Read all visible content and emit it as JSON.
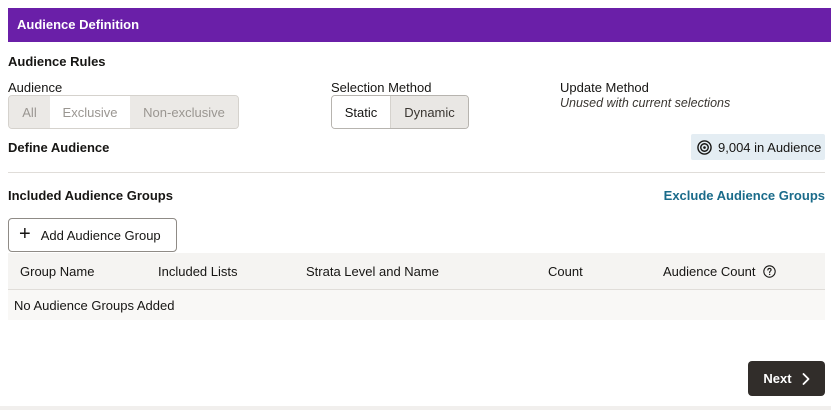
{
  "header": {
    "title": "Audience Definition"
  },
  "audience_rules": {
    "title": "Audience Rules",
    "audience": {
      "label": "Audience",
      "options": [
        "All",
        "Exclusive",
        "Non-exclusive"
      ]
    },
    "selection_method": {
      "label": "Selection Method",
      "options": [
        "Static",
        "Dynamic"
      ],
      "selected": "Static"
    },
    "update_method": {
      "label": "Update Method",
      "value": "Unused with current selections"
    }
  },
  "define_audience": {
    "title": "Define Audience",
    "badge": "9,004 in Audience",
    "badge_icon": "target-icon"
  },
  "groups": {
    "title": "Included Audience Groups",
    "exclude_link": "Exclude Audience Groups",
    "add_button": "Add Audience Group",
    "columns": [
      "Group Name",
      "Included Lists",
      "Strata Level and Name",
      "Count",
      "Audience Count"
    ],
    "empty_text": "No Audience Groups Added"
  },
  "footer": {
    "next_label": "Next"
  },
  "colors": {
    "header_bg": "#6a1fa8",
    "link": "#1a6b8a",
    "primary_button": "#312d2a",
    "badge_bg": "#e4edf3"
  }
}
